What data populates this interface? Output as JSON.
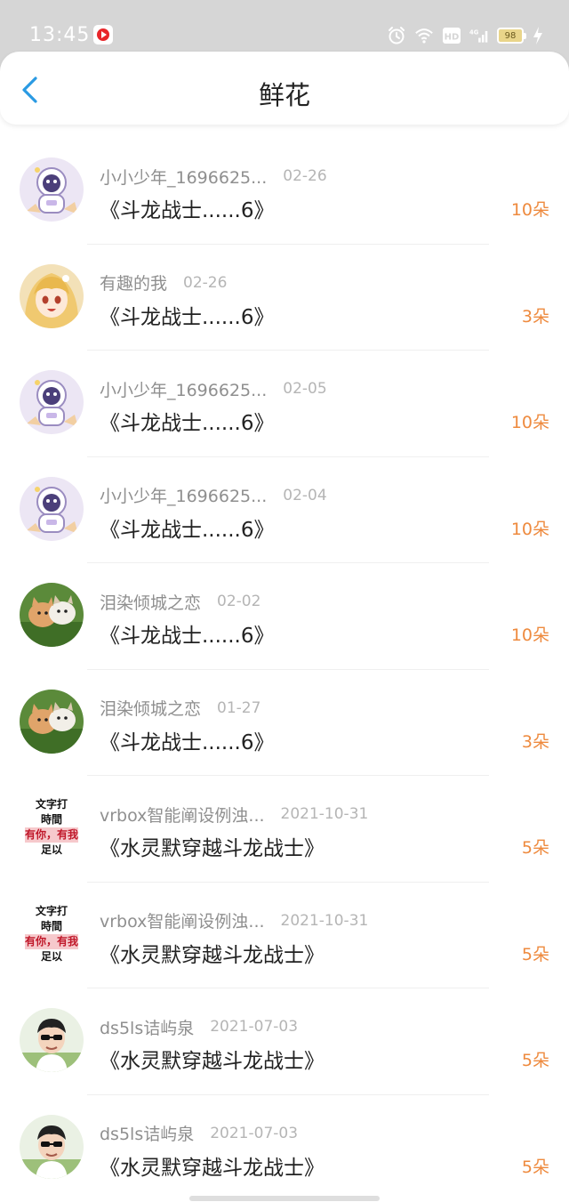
{
  "status_bar": {
    "time": "13:45",
    "battery_level": "98",
    "network_label": "4G"
  },
  "header": {
    "title": "鲜花",
    "back_icon": "chevron-left-icon"
  },
  "colors": {
    "accent_blue": "#2a9ae3",
    "flower_count_orange": "#ee8a3e",
    "meta_gray": "#8f8f8f",
    "status_bar_bg": "#d6d6d6"
  },
  "items": [
    {
      "user": "小小少年_1696625...",
      "date": "02-26",
      "book": "《斗龙战士......6》",
      "count": "10朵",
      "avatar": "astronaut"
    },
    {
      "user": "有趣的我",
      "date": "02-26",
      "book": "《斗龙战士......6》",
      "count": "3朵",
      "avatar": "anime-girl"
    },
    {
      "user": "小小少年_1696625...",
      "date": "02-05",
      "book": "《斗龙战士......6》",
      "count": "10朵",
      "avatar": "astronaut"
    },
    {
      "user": "小小少年_1696625...",
      "date": "02-04",
      "book": "《斗龙战士......6》",
      "count": "10朵",
      "avatar": "astronaut"
    },
    {
      "user": "泪染倾城之恋",
      "date": "02-02",
      "book": "《斗龙战士......6》",
      "count": "10朵",
      "avatar": "kittens"
    },
    {
      "user": "泪染倾城之恋",
      "date": "01-27",
      "book": "《斗龙战士......6》",
      "count": "3朵",
      "avatar": "kittens"
    },
    {
      "user": "vrbox智能阐设例浊...",
      "date": "2021-10-31",
      "book": "《水灵默穿越斗龙战士》",
      "count": "5朵",
      "avatar": "text-meme",
      "avatar_text": [
        "文字打",
        "時間",
        "有你，有我",
        "足以"
      ]
    },
    {
      "user": "vrbox智能阐设例浊...",
      "date": "2021-10-31",
      "book": "《水灵默穿越斗龙战士》",
      "count": "5朵",
      "avatar": "text-meme",
      "avatar_text": [
        "文字打",
        "時間",
        "有你，有我",
        "足以"
      ]
    },
    {
      "user": "ds5ls诘屿泉",
      "date": "2021-07-03",
      "book": "《水灵默穿越斗龙战士》",
      "count": "5朵",
      "avatar": "boy-sunglasses"
    },
    {
      "user": "ds5ls诘屿泉",
      "date": "2021-07-03",
      "book": "《水灵默穿越斗龙战士》",
      "count": "5朵",
      "avatar": "boy-sunglasses"
    }
  ]
}
